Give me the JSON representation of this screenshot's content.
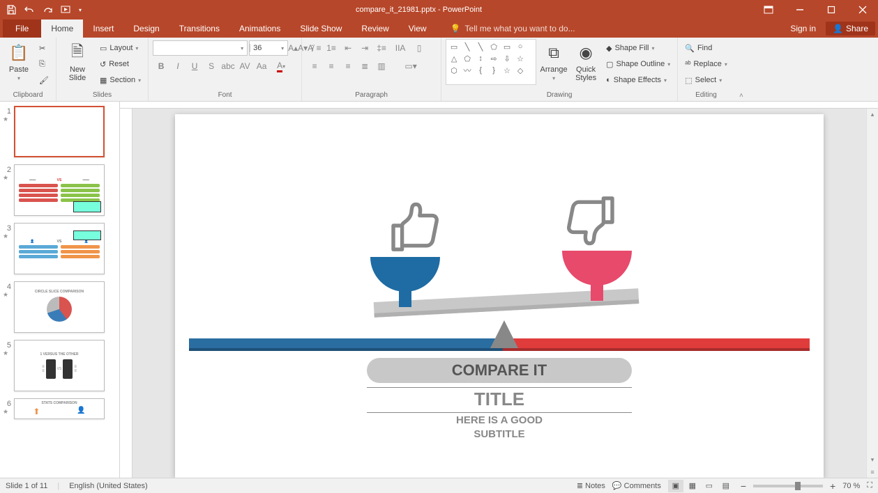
{
  "titlebar": {
    "filename": "compare_it_21981.pptx - PowerPoint"
  },
  "tabs": {
    "file": "File",
    "home": "Home",
    "insert": "Insert",
    "design": "Design",
    "transitions": "Transitions",
    "animations": "Animations",
    "slideshow": "Slide Show",
    "review": "Review",
    "view": "View",
    "tellme": "Tell me what you want to do...",
    "signin": "Sign in",
    "share": "Share"
  },
  "ribbon": {
    "clipboard": {
      "label": "Clipboard",
      "paste": "Paste"
    },
    "slides": {
      "label": "Slides",
      "newslide": "New\nSlide",
      "layout": "Layout",
      "reset": "Reset",
      "section": "Section"
    },
    "font": {
      "label": "Font",
      "size": "36"
    },
    "paragraph": {
      "label": "Paragraph"
    },
    "drawing": {
      "label": "Drawing",
      "arrange": "Arrange",
      "quick": "Quick\nStyles",
      "fill": "Shape Fill",
      "outline": "Shape Outline",
      "effects": "Shape Effects"
    },
    "editing": {
      "label": "Editing",
      "find": "Find",
      "replace": "Replace",
      "select": "Select"
    }
  },
  "slide": {
    "compare": "COMPARE IT",
    "title": "TITLE",
    "sub1": "HERE IS A GOOD",
    "sub2": "SUBTITLE"
  },
  "thumbs": {
    "t2": "CIRCLE SLICE COMPARISON",
    "t5": "1 VERSUS THE OTHER",
    "t6": "STATS COMPARISON"
  },
  "status": {
    "slide": "Slide 1 of 11",
    "lang": "English (United States)",
    "notes": "Notes",
    "comments": "Comments",
    "zoom": "70 %"
  }
}
